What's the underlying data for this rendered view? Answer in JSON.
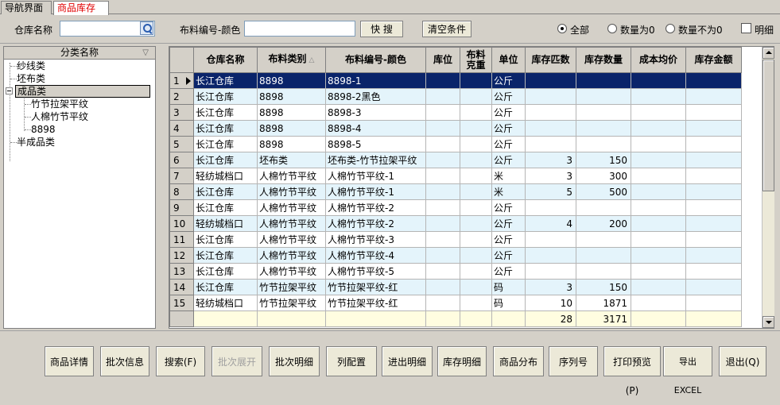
{
  "tabs": [
    {
      "label": "导航界面"
    },
    {
      "label": "商品库存"
    }
  ],
  "filter": {
    "warehouse_label": "仓库名称",
    "warehouse_value": "",
    "code_label": "布料编号-颜色",
    "code_value": "",
    "quick_search": "快 搜",
    "clear": "清空条件",
    "radio_all": "全部",
    "radio_zero": "数量为0",
    "radio_nonzero": "数量不为0",
    "detail_check": "明细"
  },
  "tree": {
    "header": "分类名称",
    "nodes": [
      "纱线类",
      "坯布类",
      "成品类",
      "竹节拉架平纹",
      "人棉竹节平纹",
      "8898",
      "半成品类"
    ]
  },
  "grid": {
    "columns": [
      "仓库名称",
      "布料类别",
      "布料编号-颜色",
      "库位",
      "布料克重",
      "单位",
      "库存匹数",
      "库存数量",
      "成本均价",
      "库存金额"
    ],
    "rows": [
      {
        "n": "1",
        "warehouse": "长江仓库",
        "category": "8898",
        "code": "8898-1",
        "loc": "",
        "weight": "",
        "unit": "公斤",
        "pieces": "",
        "qty": "",
        "cost": "",
        "amount": ""
      },
      {
        "n": "2",
        "warehouse": "长江仓库",
        "category": "8898",
        "code": "8898-2黑色",
        "loc": "",
        "weight": "",
        "unit": "公斤",
        "pieces": "",
        "qty": "",
        "cost": "",
        "amount": ""
      },
      {
        "n": "3",
        "warehouse": "长江仓库",
        "category": "8898",
        "code": "8898-3",
        "loc": "",
        "weight": "",
        "unit": "公斤",
        "pieces": "",
        "qty": "",
        "cost": "",
        "amount": ""
      },
      {
        "n": "4",
        "warehouse": "长江仓库",
        "category": "8898",
        "code": "8898-4",
        "loc": "",
        "weight": "",
        "unit": "公斤",
        "pieces": "",
        "qty": "",
        "cost": "",
        "amount": ""
      },
      {
        "n": "5",
        "warehouse": "长江仓库",
        "category": "8898",
        "code": "8898-5",
        "loc": "",
        "weight": "",
        "unit": "公斤",
        "pieces": "",
        "qty": "",
        "cost": "",
        "amount": ""
      },
      {
        "n": "6",
        "warehouse": "长江仓库",
        "category": "坯布类",
        "code": "坯布类-竹节拉架平纹",
        "loc": "",
        "weight": "",
        "unit": "公斤",
        "pieces": "3",
        "qty": "150",
        "cost": "",
        "amount": ""
      },
      {
        "n": "7",
        "warehouse": "轻纺城档口",
        "category": "人棉竹节平纹",
        "code": "人棉竹节平纹-1",
        "loc": "",
        "weight": "",
        "unit": "米",
        "pieces": "3",
        "qty": "300",
        "cost": "",
        "amount": ""
      },
      {
        "n": "8",
        "warehouse": "长江仓库",
        "category": "人棉竹节平纹",
        "code": "人棉竹节平纹-1",
        "loc": "",
        "weight": "",
        "unit": "米",
        "pieces": "5",
        "qty": "500",
        "cost": "",
        "amount": ""
      },
      {
        "n": "9",
        "warehouse": "长江仓库",
        "category": "人棉竹节平纹",
        "code": "人棉竹节平纹-2",
        "loc": "",
        "weight": "",
        "unit": "公斤",
        "pieces": "",
        "qty": "",
        "cost": "",
        "amount": ""
      },
      {
        "n": "10",
        "warehouse": "轻纺城档口",
        "category": "人棉竹节平纹",
        "code": "人棉竹节平纹-2",
        "loc": "",
        "weight": "",
        "unit": "公斤",
        "pieces": "4",
        "qty": "200",
        "cost": "",
        "amount": ""
      },
      {
        "n": "11",
        "warehouse": "长江仓库",
        "category": "人棉竹节平纹",
        "code": "人棉竹节平纹-3",
        "loc": "",
        "weight": "",
        "unit": "公斤",
        "pieces": "",
        "qty": "",
        "cost": "",
        "amount": ""
      },
      {
        "n": "12",
        "warehouse": "长江仓库",
        "category": "人棉竹节平纹",
        "code": "人棉竹节平纹-4",
        "loc": "",
        "weight": "",
        "unit": "公斤",
        "pieces": "",
        "qty": "",
        "cost": "",
        "amount": ""
      },
      {
        "n": "13",
        "warehouse": "长江仓库",
        "category": "人棉竹节平纹",
        "code": "人棉竹节平纹-5",
        "loc": "",
        "weight": "",
        "unit": "公斤",
        "pieces": "",
        "qty": "",
        "cost": "",
        "amount": ""
      },
      {
        "n": "14",
        "warehouse": "长江仓库",
        "category": "竹节拉架平纹",
        "code": "竹节拉架平纹-红",
        "loc": "",
        "weight": "",
        "unit": "码",
        "pieces": "3",
        "qty": "150",
        "cost": "",
        "amount": ""
      },
      {
        "n": "15",
        "warehouse": "轻纺城档口",
        "category": "竹节拉架平纹",
        "code": "竹节拉架平纹-红",
        "loc": "",
        "weight": "",
        "unit": "码",
        "pieces": "10",
        "qty": "1871",
        "cost": "",
        "amount": ""
      }
    ],
    "totals": {
      "pieces": "28",
      "qty": "3171"
    }
  },
  "buttons": {
    "product_detail": "商品详情",
    "batch_info": "批次信息",
    "search": "搜索(F)",
    "batch_expand": "批次展开",
    "batch_detail": "批次明细",
    "column_config": "列配置",
    "in_out_detail": "进出明细",
    "stock_detail": "库存明细",
    "product_distribution": "商品分布",
    "serial_no": "序列号",
    "print_preview": "打印预览(P)",
    "export_excel": "导出EXCEL",
    "exit": "退出(Q)"
  }
}
